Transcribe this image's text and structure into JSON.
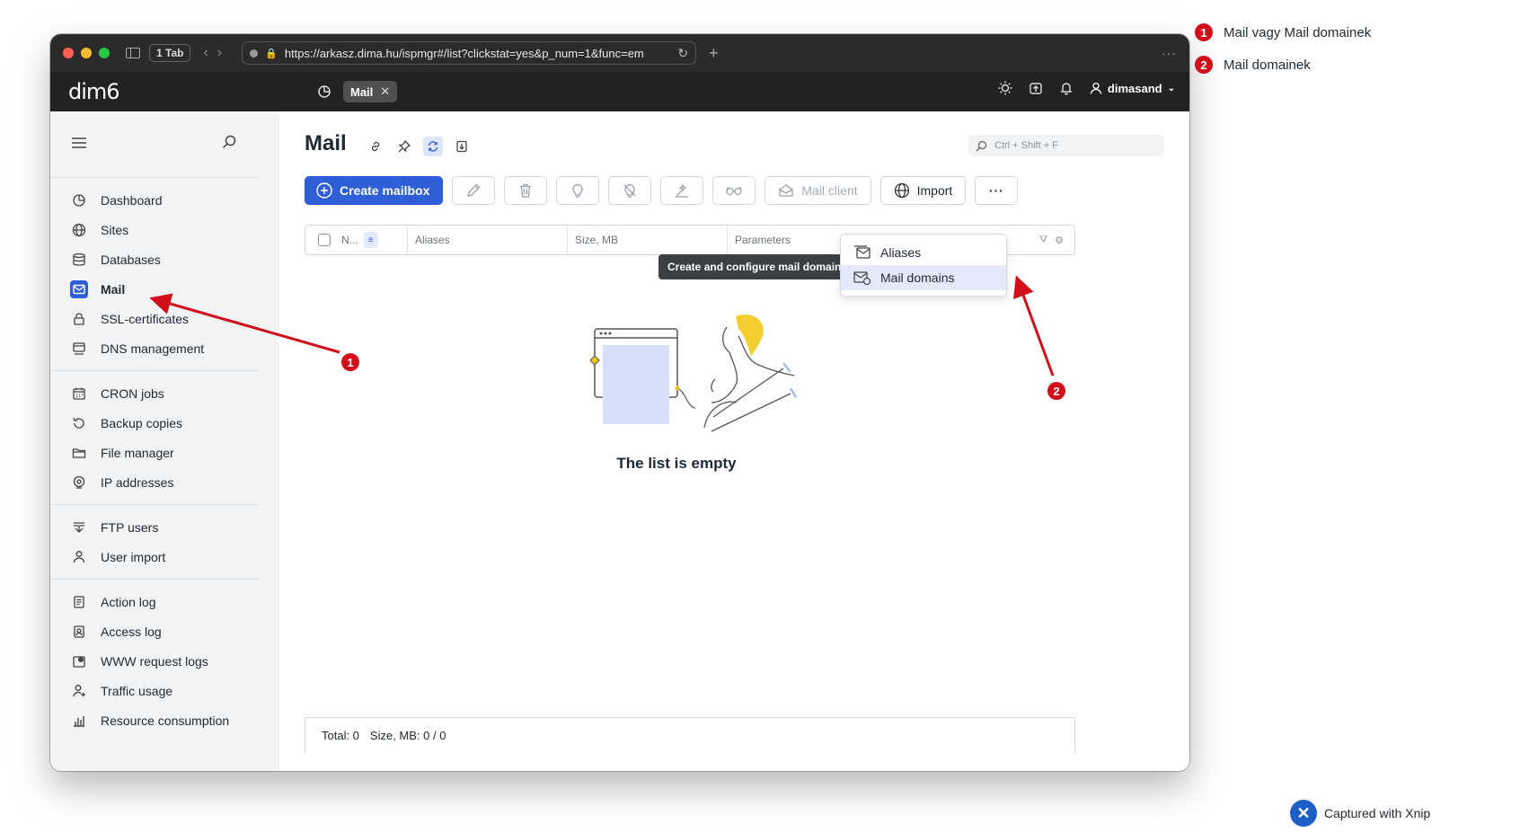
{
  "browser": {
    "tab_count": "1 Tab",
    "url": "https://arkasz.dima.hu/ispmgr#/list?clickstat=yes&p_num=1&func=em"
  },
  "header": {
    "logo": "dim6",
    "active_tab": "Mail",
    "username": "dimasand"
  },
  "sidebar": {
    "groups": [
      [
        {
          "label": "Dashboard",
          "icon": "dashboard-icon"
        },
        {
          "label": "Sites",
          "icon": "globe-icon"
        },
        {
          "label": "Databases",
          "icon": "database-icon"
        },
        {
          "label": "Mail",
          "icon": "mail-icon",
          "active": true
        },
        {
          "label": "SSL-certificates",
          "icon": "lock-icon"
        },
        {
          "label": "DNS management",
          "icon": "dns-icon"
        }
      ],
      [
        {
          "label": "CRON jobs",
          "icon": "calendar-icon"
        },
        {
          "label": "Backup copies",
          "icon": "backup-icon"
        },
        {
          "label": "File manager",
          "icon": "folder-icon"
        },
        {
          "label": "IP addresses",
          "icon": "location-icon"
        }
      ],
      [
        {
          "label": "FTP users",
          "icon": "ftp-icon"
        },
        {
          "label": "User import",
          "icon": "user-import-icon"
        }
      ],
      [
        {
          "label": "Action log",
          "icon": "action-log-icon"
        },
        {
          "label": "Access log",
          "icon": "access-log-icon"
        },
        {
          "label": "WWW request logs",
          "icon": "www-log-icon"
        },
        {
          "label": "Traffic usage",
          "icon": "traffic-icon"
        },
        {
          "label": "Resource consumption",
          "icon": "chart-icon"
        }
      ]
    ]
  },
  "main": {
    "title": "Mail",
    "search_placeholder": "Ctrl + Shift + F",
    "toolbar": {
      "create_label": "Create mailbox",
      "mail_client_label": "Mail client",
      "import_label": "Import",
      "more_label": "···"
    },
    "columns": [
      "N...",
      "Aliases",
      "Size, MB",
      "Parameters"
    ],
    "empty_text": "The list is empty",
    "footer": {
      "total": "Total: 0",
      "size": "Size, MB: 0 / 0"
    },
    "dropdown": {
      "items": [
        "Aliases",
        "Mail domains"
      ],
      "tooltip": "Create and configure mail domains"
    }
  },
  "annotations": {
    "legend": [
      {
        "number": "1",
        "text": "Mail vagy Mail domainek"
      },
      {
        "number": "2",
        "text": "Mail domainek"
      }
    ],
    "marker_color": "#d10f1b",
    "credit": "Captured with Xnip"
  },
  "colors": {
    "accent": "#2f5fd8",
    "header_bg": "#222222",
    "sidebar_bg": "#f2f3f5"
  }
}
